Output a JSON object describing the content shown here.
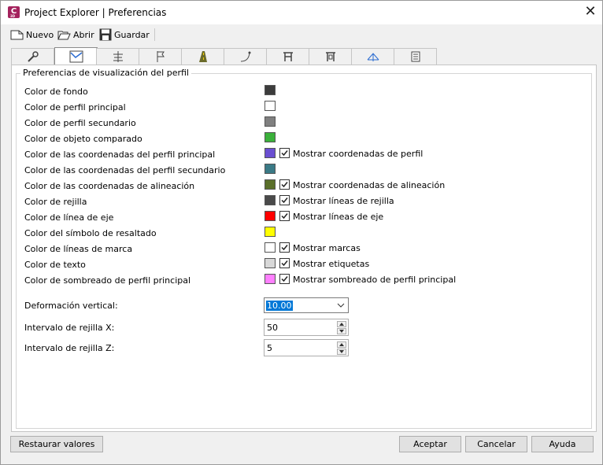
{
  "window": {
    "title": "Project Explorer | Preferencias",
    "app_icon_letter": "C",
    "app_icon_sub": "3D",
    "close_glyph": "✕"
  },
  "toolbar": {
    "new_label": "Nuevo",
    "open_label": "Abrir",
    "save_label": "Guardar"
  },
  "tabs": [
    {
      "icon": "wrench-icon"
    },
    {
      "icon": "profile-icon",
      "active": true
    },
    {
      "icon": "alignment-icon"
    },
    {
      "icon": "flag-icon"
    },
    {
      "icon": "road-icon"
    },
    {
      "icon": "curve-icon"
    },
    {
      "icon": "structure-icon"
    },
    {
      "icon": "pipe-structure-icon"
    },
    {
      "icon": "section-icon"
    },
    {
      "icon": "list-icon"
    }
  ],
  "group_title": "Preferencias de visualización del perfil",
  "color_rows": [
    {
      "label": "Color de fondo",
      "color": "#3c3c3c"
    },
    {
      "label": "Color de perfil principal",
      "color": "#ffffff"
    },
    {
      "label": "Color de perfil secundario",
      "color": "#808080"
    },
    {
      "label": "Color de objeto comparado",
      "color": "#3bb13b"
    },
    {
      "label": "Color de las coordenadas del perfil principal",
      "color": "#6a4fd1",
      "checkbox": "Mostrar coordenadas de perfil",
      "checked": true
    },
    {
      "label": "Color de las coordenadas del perfil secundario",
      "color": "#3a7a86"
    },
    {
      "label": "Color de las coordenadas de alineación",
      "color": "#5a6f2a",
      "checkbox": "Mostrar coordenadas de alineación",
      "checked": true
    },
    {
      "label": "Color de rejilla",
      "color": "#4a4a4a",
      "checkbox": "Mostrar líneas de rejilla",
      "checked": true
    },
    {
      "label": "Color de línea de eje",
      "color": "#ff0000",
      "checkbox": "Mostrar líneas de eje",
      "checked": true
    },
    {
      "label": "Color del símbolo de resaltado",
      "color": "#ffff00"
    },
    {
      "label": "Color de líneas de marca",
      "color": "#ffffff",
      "checkbox": "Mostrar marcas",
      "checked": true
    },
    {
      "label": "Color de texto",
      "color": "#d8d8d8",
      "checkbox": "Mostrar etiquetas",
      "checked": true
    },
    {
      "label": "Color de sombreado de perfil principal",
      "color": "#ff80ff",
      "checkbox": "Mostrar sombreado de perfil principal",
      "checked": true
    }
  ],
  "vertical_exaggeration": {
    "label": "Deformación vertical:",
    "value": "10.00"
  },
  "grid_x": {
    "label": "Intervalo de rejilla X:",
    "value": "50"
  },
  "grid_z": {
    "label": "Intervalo de rejilla Z:",
    "value": "5"
  },
  "buttons": {
    "restore": "Restaurar valores",
    "accept": "Aceptar",
    "cancel": "Cancelar",
    "help": "Ayuda"
  }
}
